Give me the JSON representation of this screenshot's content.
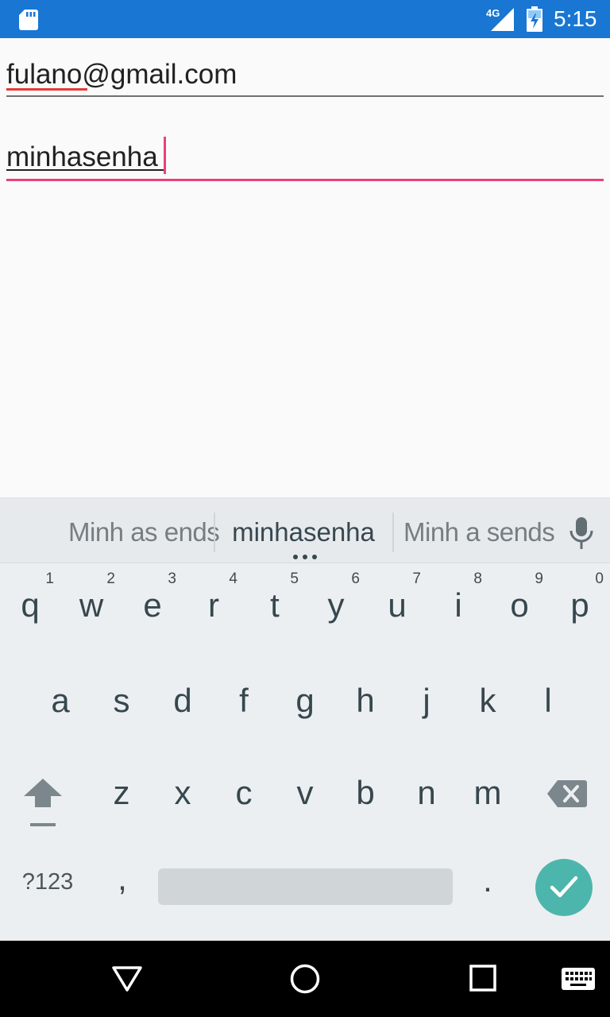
{
  "status_bar": {
    "network": "4G",
    "time": "5:15",
    "icons": [
      "sd-card-icon",
      "signal-icon",
      "battery-charging-icon"
    ]
  },
  "form": {
    "email": {
      "value": "fulano@gmail.com"
    },
    "password": {
      "value": "minhasenha"
    }
  },
  "keyboard": {
    "suggestions": [
      "Minh as ends",
      "minhasenha",
      "Minh a sends"
    ],
    "row1": [
      {
        "char": "q",
        "hint": "1"
      },
      {
        "char": "w",
        "hint": "2"
      },
      {
        "char": "e",
        "hint": "3"
      },
      {
        "char": "r",
        "hint": "4"
      },
      {
        "char": "t",
        "hint": "5"
      },
      {
        "char": "y",
        "hint": "6"
      },
      {
        "char": "u",
        "hint": "7"
      },
      {
        "char": "i",
        "hint": "8"
      },
      {
        "char": "o",
        "hint": "9"
      },
      {
        "char": "p",
        "hint": "0"
      }
    ],
    "row2": [
      "a",
      "s",
      "d",
      "f",
      "g",
      "h",
      "j",
      "k",
      "l"
    ],
    "row3": [
      "z",
      "x",
      "c",
      "v",
      "b",
      "n",
      "m"
    ],
    "symbols_label": "?123",
    "comma_label": ",",
    "period_label": ".",
    "icons": [
      "shift-icon",
      "backspace-icon",
      "mic-icon",
      "check-icon"
    ]
  },
  "nav_bar": {
    "icons": [
      "back-icon",
      "home-icon",
      "recents-icon",
      "keyboard-switch-icon"
    ]
  },
  "colors": {
    "status_bar": "#1976d2",
    "accent": "#ec407a",
    "enter_key": "#4db6ac",
    "keyboard_bg": "#eceff1"
  }
}
